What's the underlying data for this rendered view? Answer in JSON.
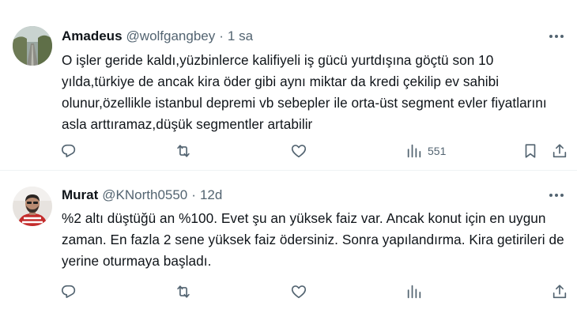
{
  "tweets": [
    {
      "name": "Amadeus",
      "handle": "@wolfgangbey",
      "sep": "·",
      "time": "1 sa",
      "text": "O işler geride kaldı,yüzbinlerce kalifiyeli iş gücü yurtdışına göçtü son 10 yılda,türkiye de ancak kira öder gibi aynı miktar da kredi çekilip ev sahibi olunur,özellikle istanbul depremi vb sebepler ile orta-üst segment evler fiyatlarını asla arttıramaz,düşük segmentler artabilir",
      "views": "551"
    },
    {
      "name": "Murat",
      "handle": "@KNorth0550",
      "sep": "·",
      "time": "12d",
      "text": "%2 altı düştüğü an %100. Evet şu an yüksek faiz var. Ancak konut için en uygun zaman. En fazla 2 sene yüksek faiz ödersiniz. Sonra yapılandırma. Kira getirileri de yerine oturmaya başladı.",
      "views": ""
    }
  ],
  "icons": {
    "reply": "reply-icon",
    "retweet": "retweet-icon",
    "like": "like-icon",
    "views": "views-icon",
    "bookmark": "bookmark-icon",
    "share": "share-icon",
    "more": "more-icon"
  },
  "colors": {
    "text": "#0f1419",
    "secondary": "#536471",
    "divider": "#eff3f4"
  }
}
